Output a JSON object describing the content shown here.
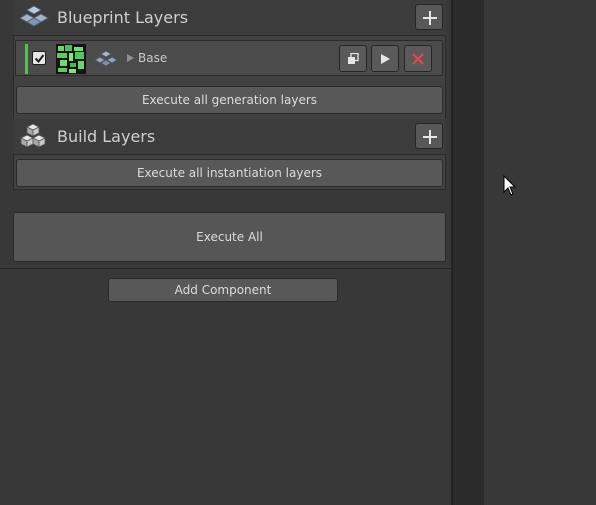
{
  "blueprint_section": {
    "title": "Blueprint Layers",
    "layers": [
      {
        "name": "Base",
        "enabled": true
      }
    ],
    "execute_button": "Execute all generation layers"
  },
  "build_section": {
    "title": "Build Layers",
    "execute_button": "Execute all instantiation layers"
  },
  "execute_all_label": "Execute All",
  "add_component_label": "Add Component",
  "colors": {
    "enabled_bar": "#3ed23a",
    "delete_icon": "#e04848",
    "background": "#383838"
  },
  "icons": {
    "blueprint_header": "stacked-hexagons-icon",
    "build_header": "stacked-cubes-icon",
    "add": "plus-icon",
    "duplicate": "duplicate-icon",
    "execute": "play-icon",
    "delete": "close-x-icon"
  }
}
